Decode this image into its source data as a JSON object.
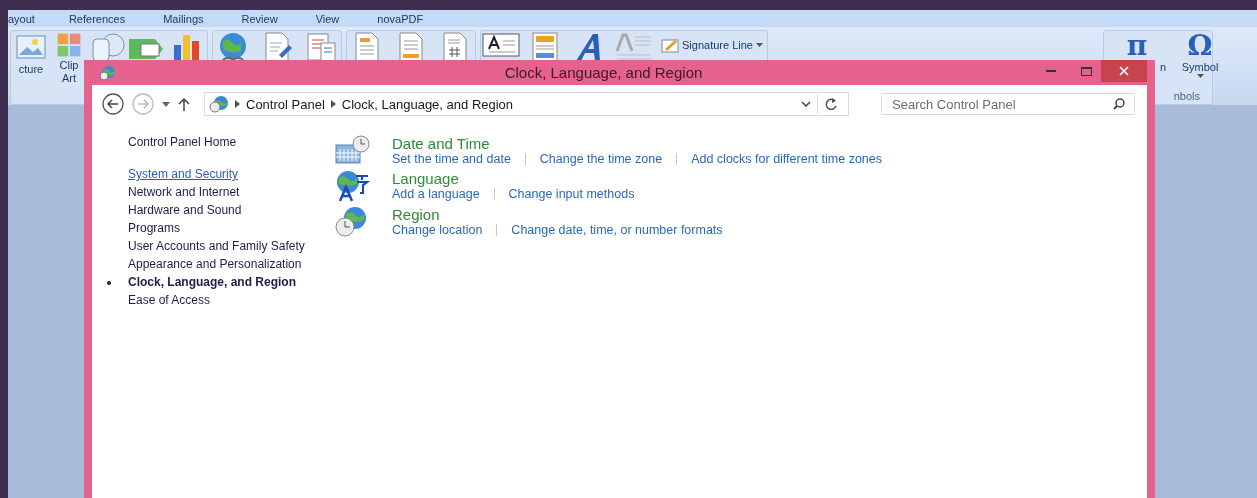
{
  "ribbon": {
    "tabs": [
      "ayout",
      "References",
      "Mailings",
      "Review",
      "View",
      "novaPDF"
    ],
    "groups": [
      {
        "buttons": [
          {
            "kind": "picture",
            "label": "cture"
          },
          {
            "kind": "clipart",
            "label": "Clip Art"
          },
          {
            "kind": "shapes"
          },
          {
            "kind": "smartart"
          },
          {
            "kind": "chart"
          }
        ]
      },
      {
        "buttons": [
          {
            "kind": "globe"
          },
          {
            "kind": "docpen"
          },
          {
            "kind": "docref"
          }
        ]
      },
      {
        "buttons": [
          {
            "kind": "doc"
          },
          {
            "kind": "docorange"
          },
          {
            "kind": "dochash"
          }
        ]
      },
      {
        "buttons": [
          {
            "kind": "textbox"
          },
          {
            "kind": "quickparts"
          },
          {
            "kind": "wordart"
          },
          {
            "kind": "dropcap"
          },
          {
            "kind": "signature",
            "label": "Signature Line"
          }
        ]
      },
      {
        "label": "nbols",
        "buttons": [
          {
            "kind": "glyph",
            "glyph": "π",
            "label": "n"
          },
          {
            "kind": "glyph",
            "glyph": "Ω",
            "label": "Symbol"
          }
        ]
      }
    ]
  },
  "window": {
    "title": "Clock, Language, and Region",
    "address": {
      "crumbs": [
        "Control Panel",
        "Clock, Language, and Region"
      ]
    },
    "search": {
      "placeholder": "Search Control Panel"
    },
    "sidebar": {
      "home": "Control Panel Home",
      "items": [
        {
          "label": "System and Security",
          "selected": false,
          "hovered": true
        },
        {
          "label": "Network and Internet",
          "selected": false,
          "hovered": false
        },
        {
          "label": "Hardware and Sound",
          "selected": false,
          "hovered": false
        },
        {
          "label": "Programs",
          "selected": false,
          "hovered": false
        },
        {
          "label": "User Accounts and Family Safety",
          "selected": false,
          "hovered": false
        },
        {
          "label": "Appearance and Personalization",
          "selected": false,
          "hovered": false
        },
        {
          "label": "Clock, Language, and Region",
          "selected": true,
          "hovered": false
        },
        {
          "label": "Ease of Access",
          "selected": false,
          "hovered": false
        }
      ]
    },
    "categories": [
      {
        "kind": "datetime",
        "title": "Date and Time",
        "links": [
          "Set the time and date",
          "Change the time zone",
          "Add clocks for different time zones"
        ]
      },
      {
        "kind": "language",
        "title": "Language",
        "links": [
          "Add a language",
          "Change input methods"
        ]
      },
      {
        "kind": "region",
        "title": "Region",
        "links": [
          "Change location",
          "Change date, time, or number formats"
        ]
      }
    ]
  }
}
